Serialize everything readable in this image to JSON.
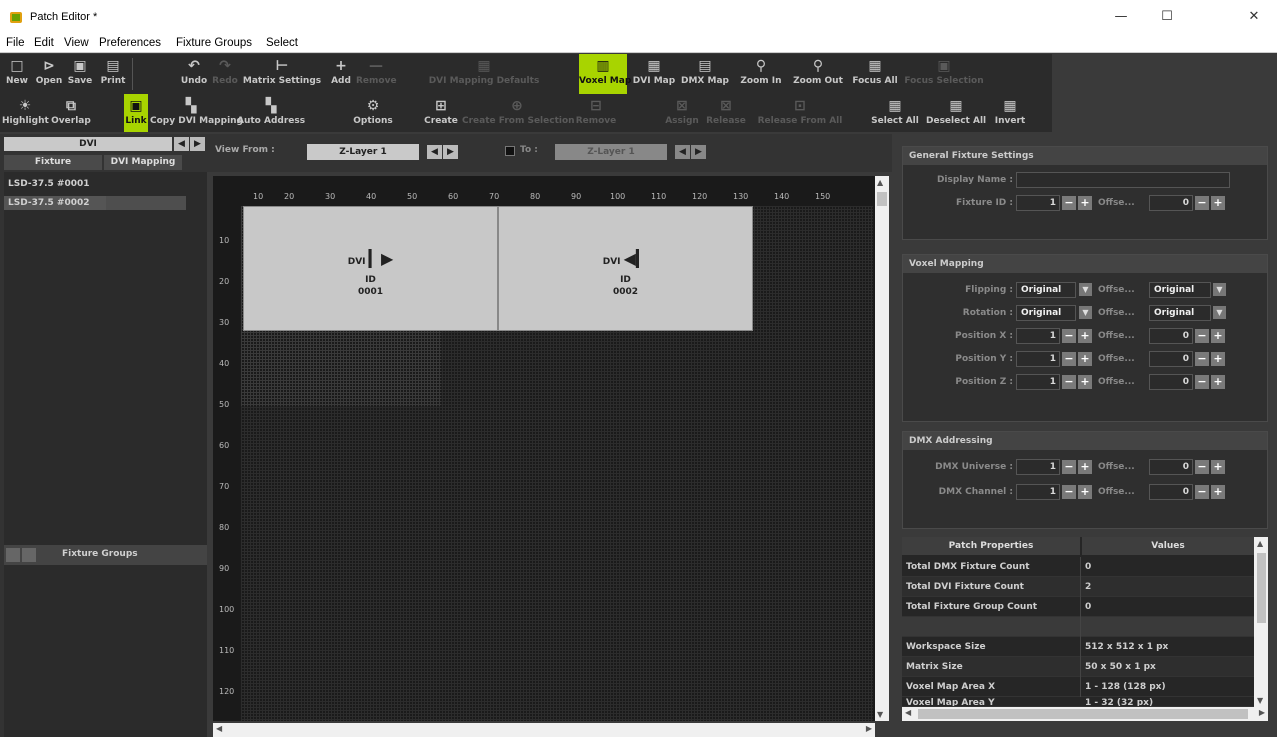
{
  "window": {
    "title": "Patch Editor *",
    "minimize": "—",
    "maximize": "☐",
    "close": "✕"
  },
  "menu": [
    "File",
    "Edit",
    "View",
    "Preferences",
    "Fixture Groups",
    "Select"
  ],
  "toolbar1": [
    {
      "label": "New",
      "icon": "□"
    },
    {
      "label": "Open",
      "icon": "⊳"
    },
    {
      "label": "Save",
      "icon": "▣"
    },
    {
      "label": "Print",
      "icon": "▤"
    },
    {
      "label": "Undo",
      "icon": "↶"
    },
    {
      "label": "Redo",
      "icon": "↷"
    },
    {
      "label": "Matrix Settings",
      "icon": "⊢"
    },
    {
      "label": "Add",
      "icon": "+"
    },
    {
      "label": "Remove",
      "icon": "—"
    },
    {
      "label": "DVI Mapping Defaults",
      "icon": "▦"
    },
    {
      "label": "Voxel Map",
      "icon": "▥"
    },
    {
      "label": "DVI Map",
      "icon": "▦"
    },
    {
      "label": "DMX Map",
      "icon": "▤"
    },
    {
      "label": "Zoom In",
      "icon": "⚲"
    },
    {
      "label": "Zoom Out",
      "icon": "⚲"
    },
    {
      "label": "Focus All",
      "icon": "▦"
    },
    {
      "label": "Focus Selection",
      "icon": "▣"
    }
  ],
  "toolbar2": [
    {
      "label": "Highlight",
      "icon": "☀"
    },
    {
      "label": "Overlap",
      "icon": "⧉"
    },
    {
      "label": "Link",
      "icon": "▣"
    },
    {
      "label": "Copy DVI Mapping",
      "icon": "▚"
    },
    {
      "label": "Auto Address",
      "icon": "▚"
    },
    {
      "label": "Options",
      "icon": "⚙"
    },
    {
      "label": "Create",
      "icon": "⊞"
    },
    {
      "label": "Create From Selection",
      "icon": "⊕"
    },
    {
      "label": "Remove",
      "icon": "⊟"
    },
    {
      "label": "Assign",
      "icon": "⊠"
    },
    {
      "label": "Release",
      "icon": "⊠"
    },
    {
      "label": "Release From All",
      "icon": "⊡"
    },
    {
      "label": "Select All",
      "icon": "▦"
    },
    {
      "label": "Deselect All",
      "icon": "▦"
    },
    {
      "label": "Invert",
      "icon": "▦"
    }
  ],
  "left": {
    "mode": "DVI",
    "col_fixture": "Fixture",
    "col_mapping": "DVI Mapping",
    "fixtures": [
      "LSD-37.5 #0001",
      "LSD-37.5 #0002"
    ],
    "groups_title": "Fixture Groups"
  },
  "view": {
    "from_label": "View From :",
    "from_value": "Z-Layer 1",
    "to_label": "To :",
    "to_value": "Z-Layer 1"
  },
  "ruler_x": [
    "10",
    "20",
    "30",
    "40",
    "50",
    "60",
    "70",
    "80",
    "90",
    "100",
    "110",
    "120",
    "130",
    "140",
    "150"
  ],
  "ruler_y": [
    "10",
    "20",
    "30",
    "40",
    "50",
    "60",
    "70",
    "80",
    "90",
    "100",
    "110",
    "120"
  ],
  "fixture_cells": [
    {
      "type": "DVI",
      "id_label": "ID",
      "id": "0001"
    },
    {
      "type": "DVI",
      "id_label": "ID",
      "id": "0002"
    }
  ],
  "general": {
    "title": "General Fixture Settings",
    "display_name_label": "Display Name :",
    "display_name": "",
    "fixture_id_label": "Fixture ID :",
    "fixture_id": "1",
    "offset_label": "Offse...",
    "offset": "0"
  },
  "voxel": {
    "title": "Voxel Mapping",
    "flipping_label": "Flipping :",
    "flipping": "Original",
    "flipping_offset": "Original",
    "rotation_label": "Rotation :",
    "rotation": "Original",
    "rotation_offset": "Original",
    "posx_label": "Position X :",
    "posx": "1",
    "posx_offset": "0",
    "posy_label": "Position Y :",
    "posy": "1",
    "posy_offset": "0",
    "posz_label": "Position Z :",
    "posz": "1",
    "posz_offset": "0",
    "offset_label": "Offse..."
  },
  "dmx": {
    "title": "DMX Addressing",
    "universe_label": "DMX Universe :",
    "universe": "1",
    "universe_offset": "0",
    "channel_label": "DMX Channel :",
    "channel": "1",
    "channel_offset": "0",
    "offset_label": "Offse..."
  },
  "props": {
    "col_prop": "Patch Properties",
    "col_val": "Values",
    "rows": [
      {
        "k": "Total DMX Fixture Count",
        "v": "0"
      },
      {
        "k": "Total DVI Fixture Count",
        "v": "2"
      },
      {
        "k": "Total Fixture Group Count",
        "v": "0"
      },
      {
        "k": "",
        "v": ""
      },
      {
        "k": "Workspace Size",
        "v": "512 x 512 x 1 px"
      },
      {
        "k": "Matrix Size",
        "v": "50 x 50 x 1 px"
      },
      {
        "k": "Voxel Map Area X",
        "v": "1 - 128 (128 px)"
      },
      {
        "k": "Voxel Map Area Y",
        "v": "1 - 32 (32 px)"
      }
    ]
  },
  "colors": {
    "accent": "#a8d400",
    "panel": "#2b2b2b",
    "fixture": "#c8c8c8"
  }
}
